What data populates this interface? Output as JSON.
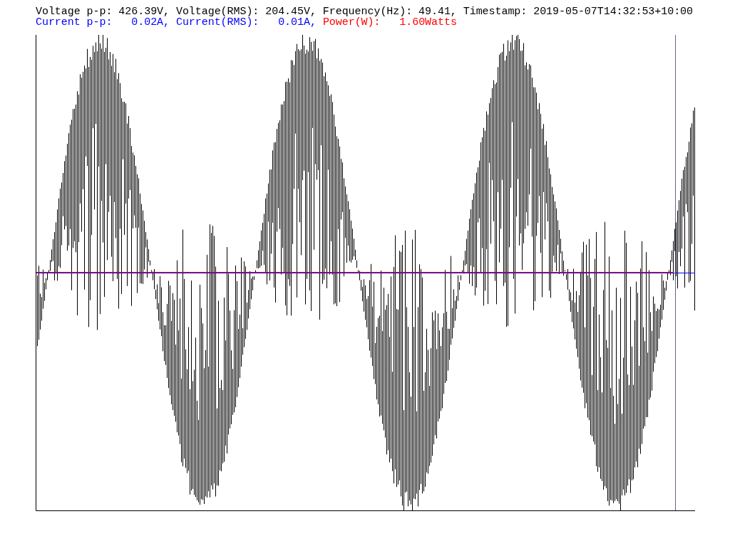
{
  "readings": [
    [
      {
        "text": "Voltage p-p: 426.39V, Voltage(RMS): 204.45V, Frequency(Hz): 49.41, Timestamp: 2019-05-07T14:32:53+10:00",
        "color": "#000000"
      }
    ],
    [
      {
        "text": "Current p-p:   0.02A, Current(RMS):   0.01A,",
        "color": "#0000ff"
      },
      {
        "text": "Power(W):   1.60Watts",
        "color": "#ff0000"
      }
    ]
  ]
}
